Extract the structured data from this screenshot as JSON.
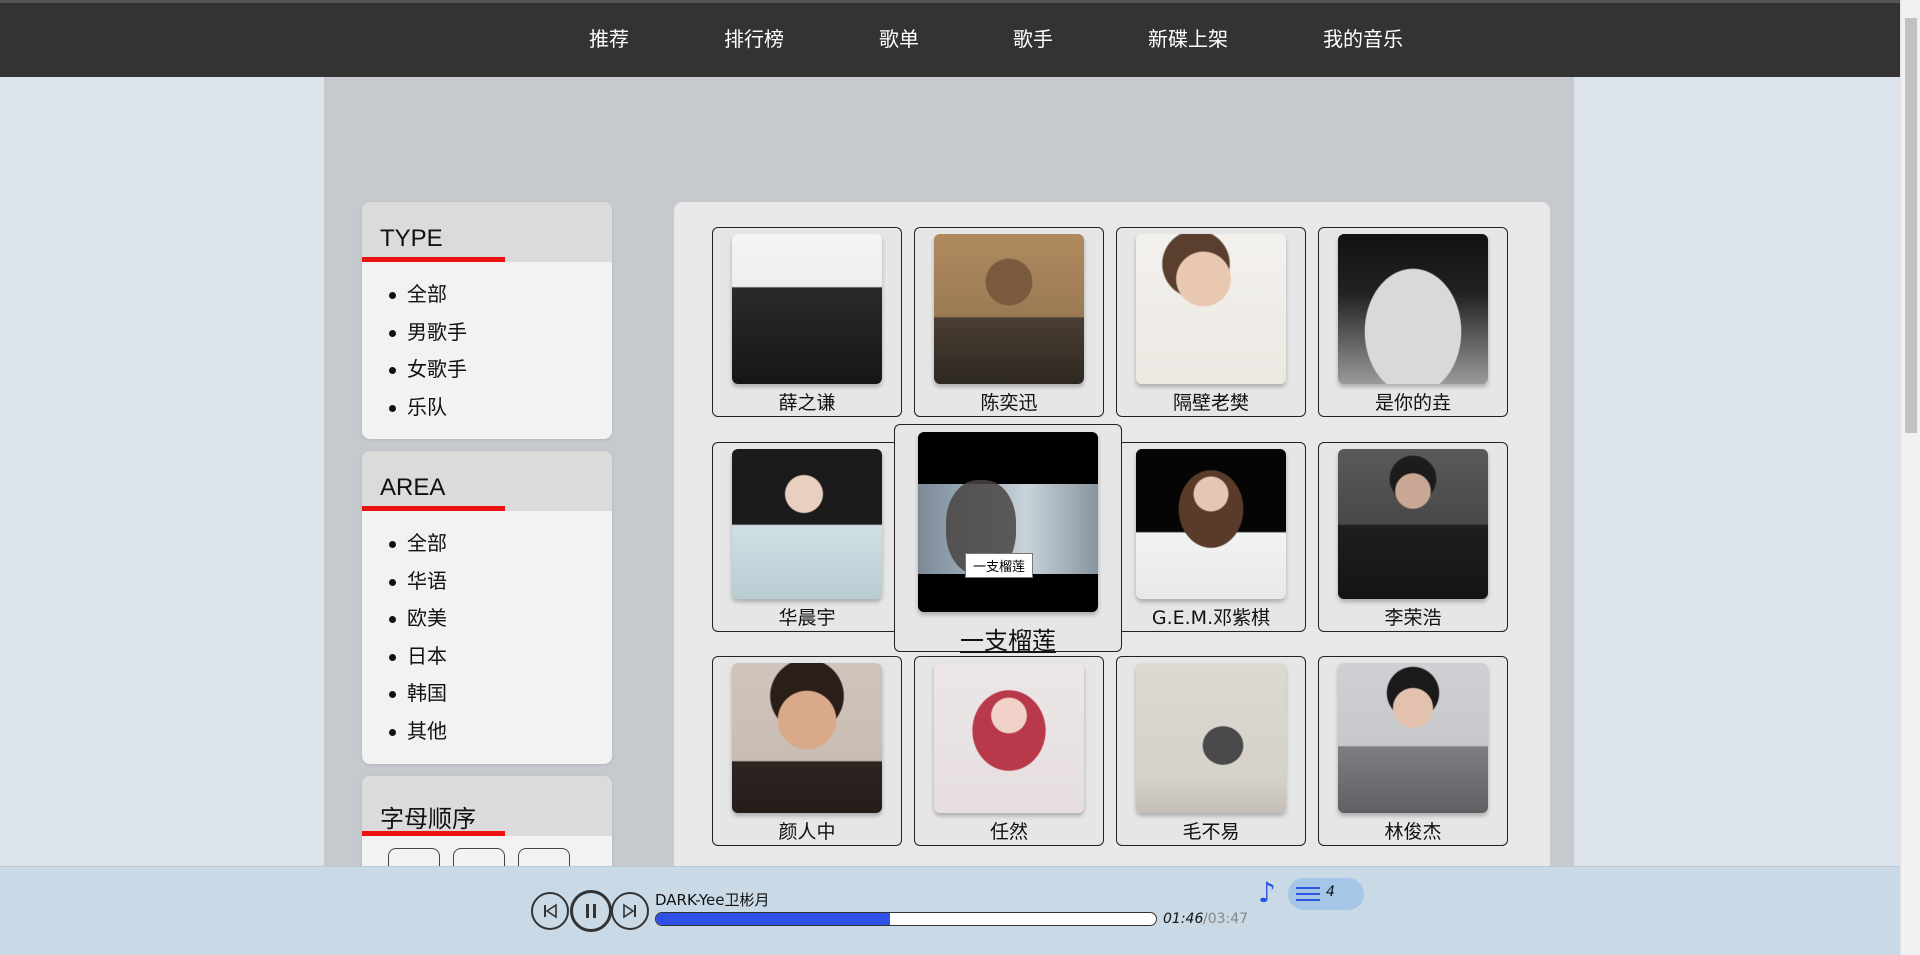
{
  "nav": {
    "items": [
      {
        "label": "推荐"
      },
      {
        "label": "排行榜"
      },
      {
        "label": "歌单"
      },
      {
        "label": "歌手"
      },
      {
        "label": "新碟上架"
      },
      {
        "label": "我的音乐"
      }
    ]
  },
  "sidebar": {
    "type": {
      "title": "TYPE",
      "items": [
        "全部",
        "男歌手",
        "女歌手",
        "乐队"
      ]
    },
    "area": {
      "title": "AREA",
      "items": [
        "全部",
        "华语",
        "欧美",
        "日本",
        "韩国",
        "其他"
      ]
    },
    "letters": {
      "title": "字母顺序"
    }
  },
  "artists": [
    {
      "name": "薛之谦"
    },
    {
      "name": "陈奕迅"
    },
    {
      "name": "隔壁老樊"
    },
    {
      "name": "是你的垚"
    },
    {
      "name": "华晨宇"
    },
    {
      "name": "一支榴莲",
      "tooltip": "一支榴莲"
    },
    {
      "name": "G.E.M.邓紫棋"
    },
    {
      "name": "李荣浩"
    },
    {
      "name": "颜人中"
    },
    {
      "name": "任然"
    },
    {
      "name": "毛不易"
    },
    {
      "name": "林俊杰"
    }
  ],
  "player": {
    "song": "DARK-Yee卫彬月",
    "current_time": "01:46",
    "total_time": "/03:47",
    "progress": 0.467,
    "playlist_count": "4",
    "accent_color": "#2f50e6"
  }
}
